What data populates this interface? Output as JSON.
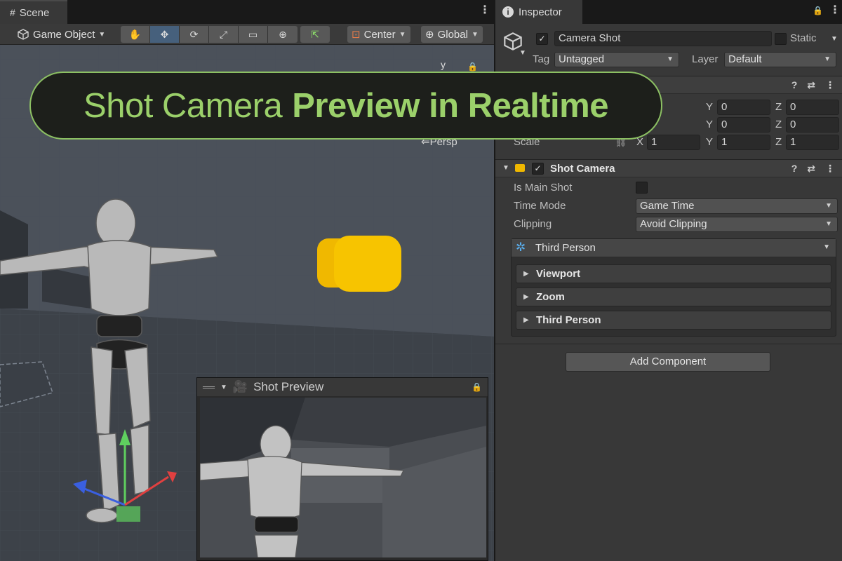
{
  "scene": {
    "tab_label": "Scene",
    "toolbar": {
      "object_mode": "Game Object",
      "pivot": "Center",
      "space": "Global"
    },
    "gizmo": {
      "y_axis": "y",
      "projection": "Persp"
    }
  },
  "banner": {
    "text_normal": "Shot Camera",
    "text_bold": "Preview in Realtime",
    "color": "#9bd06a"
  },
  "shot_preview": {
    "title": "Shot Preview"
  },
  "inspector": {
    "tab_label": "Inspector",
    "object_name": "Camera Shot",
    "static_label": "Static",
    "tag_label": "Tag",
    "tag_value": "Untagged",
    "layer_label": "Layer",
    "layer_value": "Default",
    "transform": {
      "row1": {
        "y": "0",
        "z": "0"
      },
      "row2": {
        "y": "0",
        "z": "0"
      },
      "scale_label": "Scale",
      "row3": {
        "x": "1",
        "y": "1",
        "z": "1"
      }
    },
    "axis_labels": {
      "x": "X",
      "y": "Y",
      "z": "Z"
    },
    "shot_camera": {
      "title": "Shot Camera",
      "is_main_shot_label": "Is Main Shot",
      "time_mode_label": "Time Mode",
      "time_mode_value": "Game Time",
      "clipping_label": "Clipping",
      "clipping_value": "Avoid Clipping",
      "mode_value": "Third Person",
      "sections": [
        "Viewport",
        "Zoom",
        "Third Person"
      ]
    },
    "add_component": "Add Component"
  }
}
